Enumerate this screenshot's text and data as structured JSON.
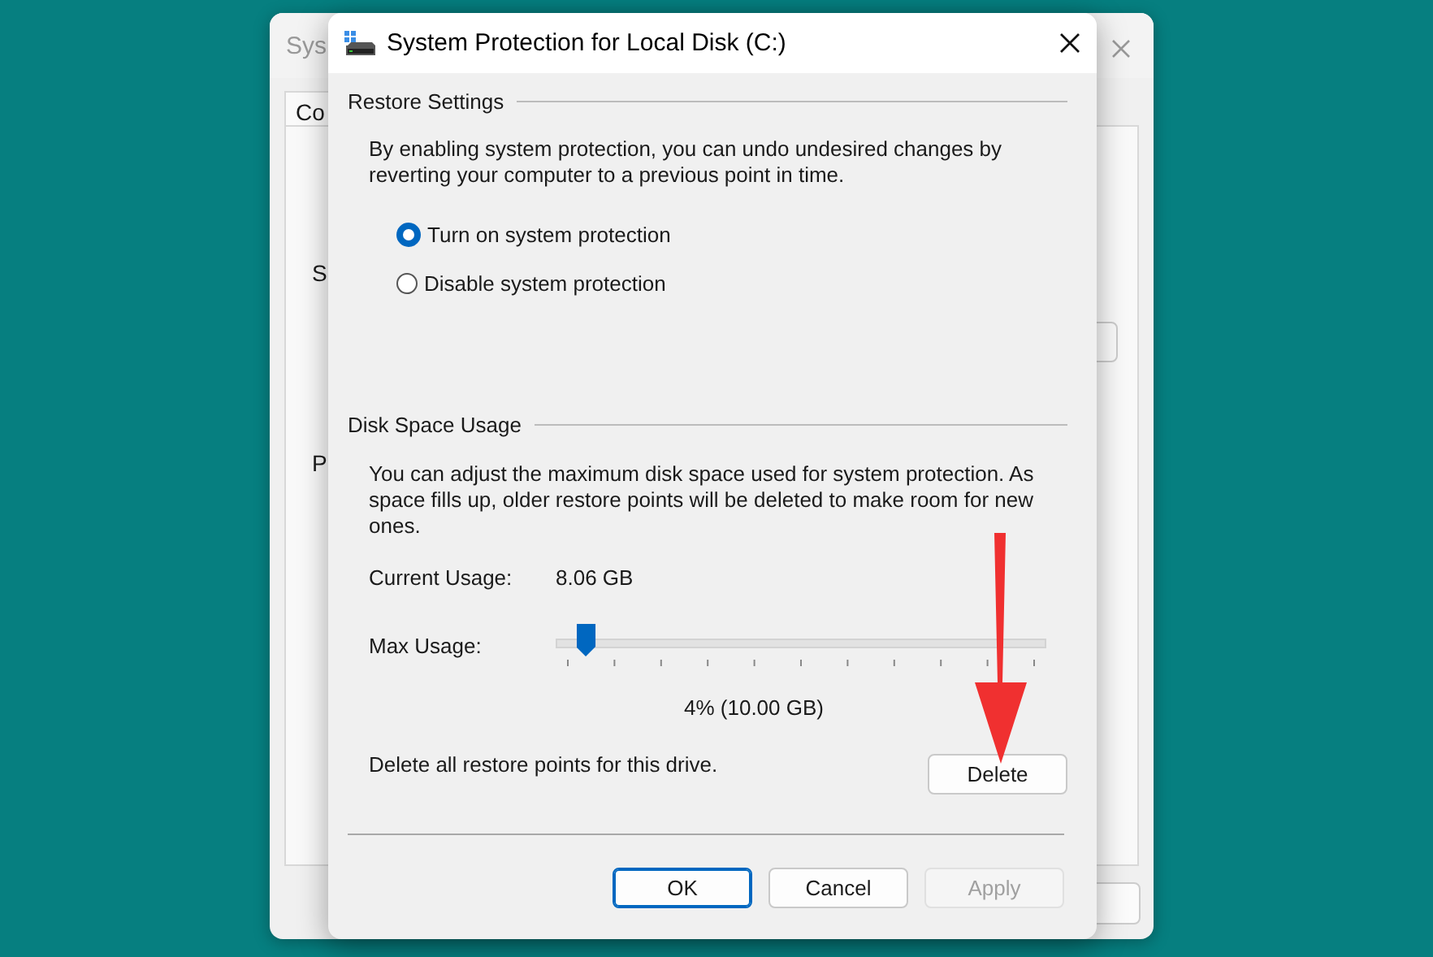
{
  "back_window": {
    "title": "Sys",
    "tab": "Co",
    "fragments": [
      "S",
      "P"
    ]
  },
  "dialog": {
    "title": "System Protection for Local Disk (C:)",
    "restore_settings": {
      "heading": "Restore Settings",
      "description": "By enabling system protection, you can undo undesired changes by reverting your computer to a previous point in time.",
      "options": [
        {
          "label": "Turn on system protection",
          "selected": true
        },
        {
          "label": "Disable system protection",
          "selected": false
        }
      ]
    },
    "disk_space_usage": {
      "heading": "Disk Space Usage",
      "description": "You can adjust the maximum disk space used for system protection. As space fills up, older restore points will be deleted to make room for new ones.",
      "current_usage_label": "Current Usage:",
      "current_usage_value": "8.06 GB",
      "max_usage_label": "Max Usage:",
      "max_usage_slider": {
        "level": 0.04
      },
      "max_usage_reading": "4% (10.00 GB)",
      "delete_text": "Delete all restore points for this drive.",
      "delete_button": "Delete"
    },
    "buttons": [
      {
        "label": "OK",
        "kind": "default",
        "disabled": false
      },
      {
        "label": "Cancel",
        "kind": "normal",
        "disabled": false
      },
      {
        "label": "Apply",
        "kind": "normal",
        "disabled": true
      }
    ]
  }
}
